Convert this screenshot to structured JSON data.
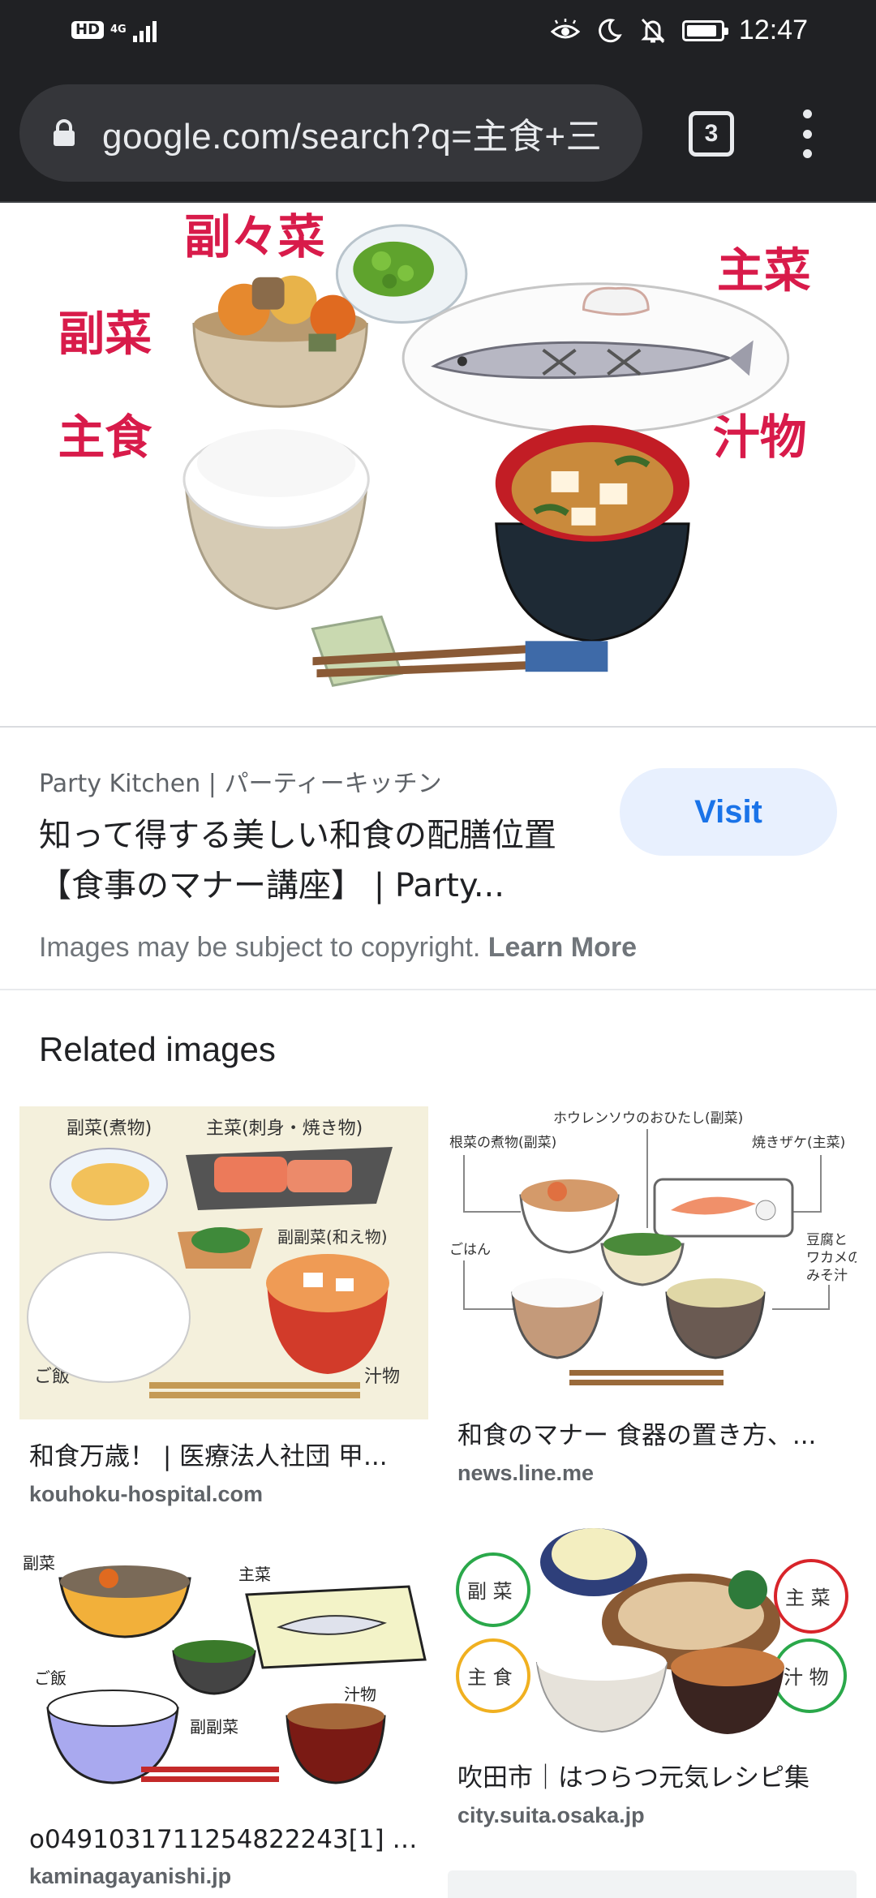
{
  "status_bar": {
    "hd": "HD",
    "network": "4G",
    "time": "12:47",
    "battery_level": 0.9
  },
  "toolbar": {
    "url": "google.com/search?q=主食+三",
    "tab_count": "3"
  },
  "preview": {
    "labels": {
      "fukufukusai": "副々菜",
      "shusai": "主菜",
      "fukusai": "副菜",
      "shushoku": "主食",
      "shirumono": "汁物"
    }
  },
  "result": {
    "source": "Party Kitchen | パーティーキッチン",
    "title": "知って得する美しい和食の配膳位置【食事のマナー講座】 | Party...",
    "visit_label": "Visit",
    "copyright_text": "Images may be subject to copyright.",
    "learn_more": "Learn More"
  },
  "related": {
    "heading": "Related images",
    "items": [
      {
        "title": "和食万歳！ | 医療法人社団 甲...",
        "site": "kouhoku-hospital.com",
        "labels": [
          "副菜(煮物)",
          "主菜(刺身・焼き物)",
          "副副菜(和え物)",
          "ご飯",
          "汁物"
        ]
      },
      {
        "title": "和食のマナー 食器の置き方、...",
        "site": "news.line.me",
        "labels": [
          "ホウレンソウのおひたし(副菜)",
          "根菜の煮物(副菜)",
          "焼きザケ(主菜)",
          "ごはん",
          "豆腐と",
          "ワカメの",
          "みそ汁"
        ]
      },
      {
        "title": "o0491031711254822243[1] –...",
        "site": "kaminagayanishi.jp",
        "labels": [
          "副菜",
          "主菜",
          "ご飯",
          "汁物",
          "副副菜"
        ]
      },
      {
        "title": "吹田市｜はつらつ元気レシピ集",
        "site": "city.suita.osaka.jp",
        "labels": [
          "副 菜",
          "主 菜",
          "主 食",
          "汁 物"
        ]
      }
    ]
  },
  "colors": {
    "chrome_dark": "#202124",
    "omnibox": "#35363a",
    "accent_blue": "#1a73e8",
    "visit_bg": "#e8f0fe",
    "label_red": "#d81b4a"
  }
}
